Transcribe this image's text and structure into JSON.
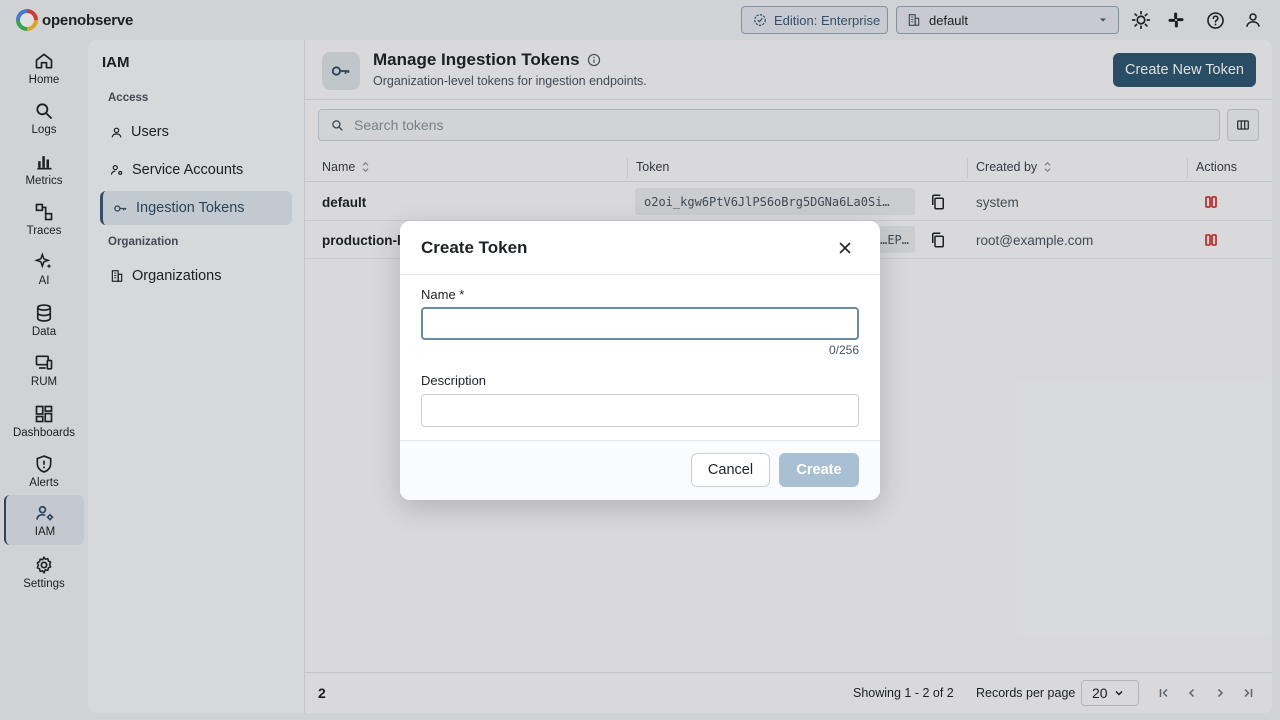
{
  "app": {
    "brand": "openobserve"
  },
  "topbar": {
    "edition_label": "Edition: Enterprise",
    "org_selected": "default"
  },
  "nav": {
    "items": [
      {
        "label": "Home",
        "icon": "home-icon"
      },
      {
        "label": "Logs",
        "icon": "search-icon"
      },
      {
        "label": "Metrics",
        "icon": "bar-chart-icon"
      },
      {
        "label": "Traces",
        "icon": "traces-icon"
      },
      {
        "label": "AI",
        "icon": "sparkles-icon"
      },
      {
        "label": "Data",
        "icon": "database-icon"
      },
      {
        "label": "RUM",
        "icon": "devices-icon"
      },
      {
        "label": "Dashboards",
        "icon": "grid-icon"
      },
      {
        "label": "Alerts",
        "icon": "shield-alert-icon"
      },
      {
        "label": "IAM",
        "icon": "users-gear-icon",
        "active": true
      },
      {
        "label": "Settings",
        "icon": "gear-icon"
      }
    ]
  },
  "iam": {
    "title": "IAM",
    "access_section": "Access",
    "items": [
      {
        "label": "Users",
        "icon": "user-icon"
      },
      {
        "label": "Service Accounts",
        "icon": "service-account-icon"
      },
      {
        "label": "Ingestion Tokens",
        "icon": "key-icon",
        "active": true
      }
    ],
    "org_section": "Organization",
    "org_items": [
      {
        "label": "Organizations",
        "icon": "building-icon"
      }
    ]
  },
  "page": {
    "title": "Manage Ingestion Tokens",
    "subtitle": "Organization-level tokens for ingestion endpoints.",
    "create_button": "Create New Token",
    "search_placeholder": "Search tokens"
  },
  "table": {
    "columns": [
      "Name",
      "Token",
      "Created by",
      "Actions"
    ],
    "rows": [
      {
        "name": "default",
        "token": "o2oi_kgw6PtV6JlPS6oBrg5DGNa6La0Si…",
        "created_by": "system"
      },
      {
        "name": "production-lo",
        "token": "…EP…",
        "created_by": "root@example.com"
      }
    ]
  },
  "footer": {
    "count": "2",
    "showing": "Showing 1 - 2 of 2",
    "records_label": "Records per page",
    "records_value": "20"
  },
  "modal": {
    "title": "Create Token",
    "name_label": "Name *",
    "name_value": "",
    "name_counter": "0/256",
    "description_label": "Description",
    "description_value": "",
    "cancel": "Cancel",
    "create": "Create"
  },
  "colors": {
    "primary": "#2f5873",
    "primary_disabled": "#a8c0d2",
    "danger": "#d93a3a"
  }
}
